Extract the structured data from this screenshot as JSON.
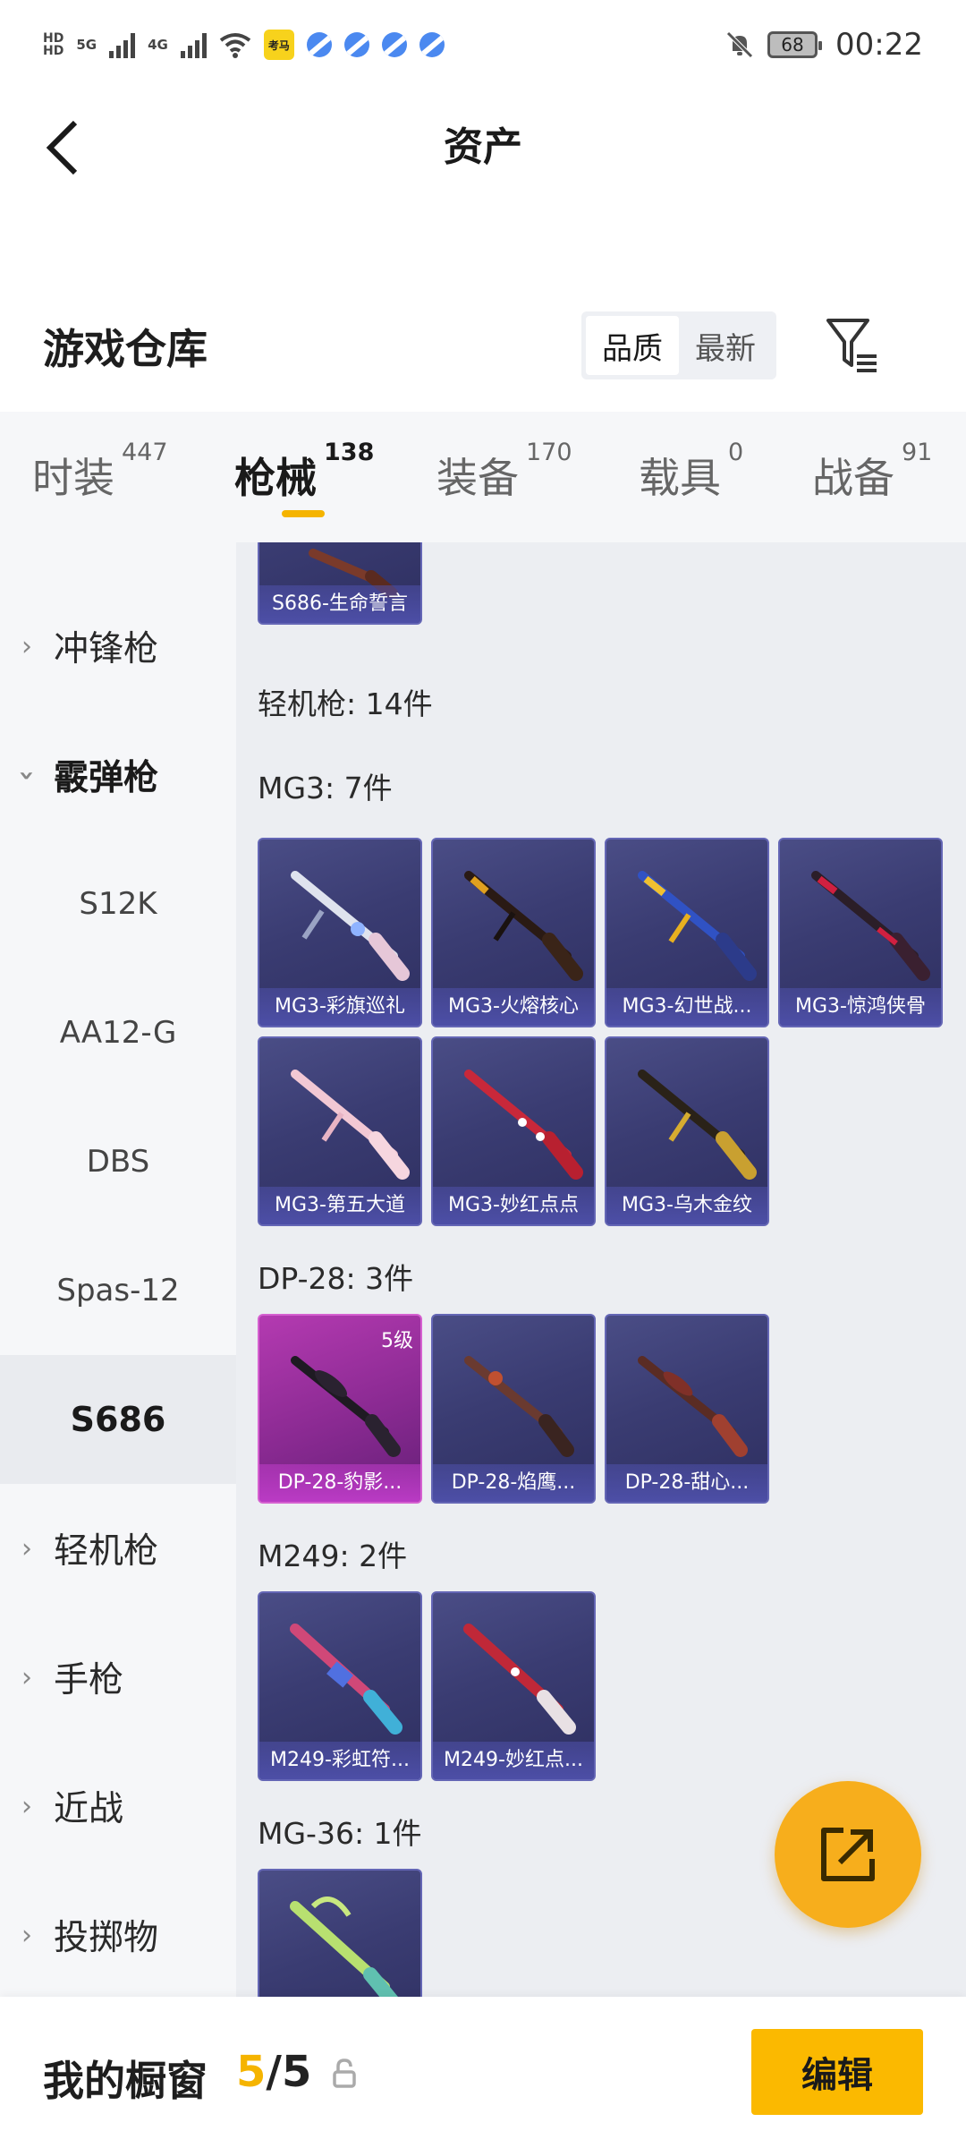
{
  "status_bar": {
    "network_1": "5G",
    "network_2": "4G",
    "battery": "68",
    "time": "00:22",
    "app_icon_text": "考马"
  },
  "nav": {
    "title": "资产",
    "back_icon": "chevron-left-icon"
  },
  "section": {
    "title": "游戏仓库",
    "sort_options": [
      "品质",
      "最新"
    ],
    "sort_selected": "品质",
    "filter_icon": "filter-icon"
  },
  "tabs": [
    {
      "label": "时装",
      "count": "447"
    },
    {
      "label": "枪械",
      "count": "138",
      "active": true
    },
    {
      "label": "装备",
      "count": "170"
    },
    {
      "label": "载具",
      "count": "0"
    },
    {
      "label": "战备",
      "count": "91"
    }
  ],
  "sidebar": {
    "items": [
      {
        "label": "冲锋枪",
        "expanded": false
      },
      {
        "label": "霰弹枪",
        "expanded": true
      },
      {
        "label": "S12K"
      },
      {
        "label": "AA12-G"
      },
      {
        "label": "DBS"
      },
      {
        "label": "Spas-12"
      },
      {
        "label": "S686",
        "selected": true
      },
      {
        "label": "轻机枪",
        "expanded": false
      },
      {
        "label": "手枪",
        "expanded": false
      },
      {
        "label": "近战",
        "expanded": false
      },
      {
        "label": "投掷物",
        "expanded": false
      }
    ]
  },
  "inventory": {
    "top_card": {
      "name": "S686-生命誓言"
    },
    "category_title": "轻机枪: 14件",
    "groups": [
      {
        "title": "MG3: 7件",
        "items": [
          "MG3-彩旗巡礼",
          "MG3-火熔核心",
          "MG3-幻世战...",
          "MG3-惊鸿侠骨",
          "MG3-第五大道",
          "MG3-妙红点点",
          "MG3-乌木金纹"
        ]
      },
      {
        "title": "DP-28: 3件",
        "items": [
          "DP-28-豹影...",
          "DP-28-焰鹰...",
          "DP-28-甜心..."
        ],
        "first_level": "5级"
      },
      {
        "title": "M249: 2件",
        "items": [
          "M249-彩虹符...",
          "M249-妙红点..."
        ]
      },
      {
        "title": "MG-36: 1件",
        "items": [
          ""
        ]
      }
    ]
  },
  "bottom_bar": {
    "label": "我的橱窗",
    "count_current": "5",
    "count_sep": "/",
    "count_total": "5",
    "edit_label": "编辑"
  },
  "colors": {
    "accent": "#f5b400",
    "card_blue": "#3a3c72",
    "card_pink": "#8a2a92",
    "fab": "#f7ae1c"
  }
}
